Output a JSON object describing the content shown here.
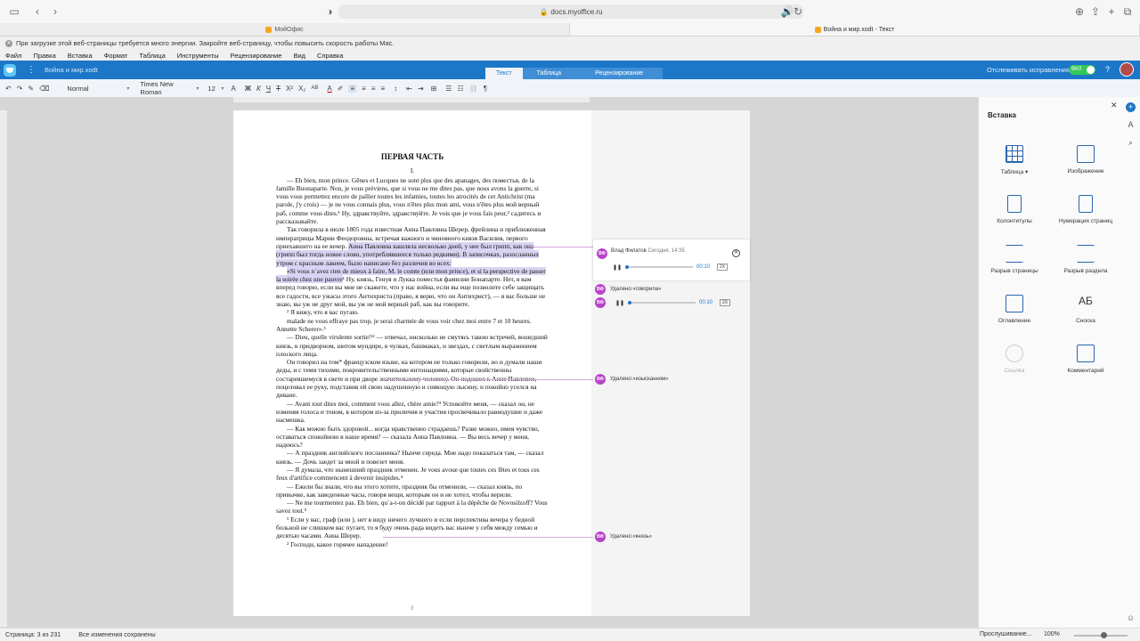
{
  "browser": {
    "url": "docs.myoffice.ru",
    "tabs": [
      {
        "label": "МойОфис",
        "active": false
      },
      {
        "label": "Война и мир.xodt - Текст",
        "active": true
      }
    ],
    "energy_warning": "При загрузке этой веб-страницы требуется много энергии. Закройте веб-страницу, чтобы повысить скорость работы Mac."
  },
  "menu": [
    "Файл",
    "Правка",
    "Вставка",
    "Формат",
    "Таблица",
    "Инструменты",
    "Рецензирование",
    "Вид",
    "Справка"
  ],
  "app": {
    "doc_title": "Война и мир.xodt",
    "mode_tabs": [
      "Текст",
      "Таблица",
      "Рецензирование"
    ],
    "active_mode": "Текст",
    "track_changes_label": "Отслеживать исправления",
    "track_toggle": "ВКЛ",
    "help": "?"
  },
  "toolbar": {
    "style": "Normal",
    "font": "Times New Roman",
    "size": "12",
    "grow_font": "A",
    "bold": "Ж",
    "italic": "К",
    "underline": "Ч",
    "strike": "T",
    "superscript": "X²",
    "subscript": "X₂",
    "case": "AB",
    "font_color": "A",
    "pilcrow": "¶"
  },
  "document": {
    "heading": "ПЕРВАЯ ЧАСТЬ",
    "chapter": "I.",
    "paragraphs": [
      {
        "indent": true,
        "text": "— Eh bien, mon prince. Gênes et Lucques ne sont plus que des apanages, des поместья, de la famille Buonaparte. Non, je vous préviens, que si vous ne me dites pas, que nous avons la guerre, si vous vous permettez encore de pallier toutes les infamies, toutes les atrocités de cet Antichrist (ma parole, j'y crois) — je ne vous connais plus, vous n'êtes plus mon ami, vous n'êtes plus мой верный раб, comme vous dites.¹ Ну, здравствуйте, здравствуйте. Je vois que je vous fais peur,² садитесь и рассказывайте."
      },
      {
        "indent": true,
        "pre": "Так говорила в июле 1805 года известная Анна Павловна Шерер, фрейлина и приближенная императрицы Марии Феодоровны, встречая важного и чиновного князя Василия, первого приехавшего на ее вечер. ",
        "hl": "Анна Павловна кашляла несколько дней, у нее был грипп, как она (грипп был тогда новое слово, употреблявшееся только редкими). В записочках, разосланных утром с красным лакеем, было написано без различия во всех:",
        "post": ""
      },
      {
        "indent": true,
        "pre": "",
        "hl": "«Si vous n`avez rien de mieux à faire, M. le comte (или mon prince), et si la perspective de passer la soirée chez une pauvre",
        "post": "¹ Ну, князь, Генуя и Лукка поместья фамилии Бонапарте. Нет, я вам вперед говорю, если вы мне не скажете, что у нас война, если вы еще позволите себе защищать все гадости, все ужасы этого Антихриста (право, я верю, что он Антихрист), — я вас больше не знаю, вы уж не друг мой, вы уж не мой верный раб, как вы говорите."
      },
      {
        "indent": true,
        "text": "² Я вижу, что я вас пугаю."
      },
      {
        "indent": true,
        "text": "malade ne vous effraye pas trop, je serai charmée de vous voir chez moi entre 7 et 10 heures. Annette Scherer».³"
      },
      {
        "indent": true,
        "text": "— Dieu, quelle virulente sortie!¹² — отвечал, нисколько не смутясь такою встречей, вошедший князь, в придворном, шитом мундире, в чулках, башмаках, и звездах, с светлым выражением плоского лица."
      },
      {
        "indent": true,
        "text": "Он говорил на том* французском языке, на котором не только говорили, но и думали наши деды, и с теми тихими, покровительственными интонациями, которые свойственны состаревшемуся в свете и при дворе значительному человеку. Он подошел к Анне Павловне, поцеловал ее руку, подставив ей свою надушенную и сияющую лысину, и покойно уселся на диване."
      },
      {
        "indent": true,
        "text": "— Avant tout dites moi, comment vous allez, chère amie?³ Успокойте меня, — сказал он, не изменяя голоса и тоном, в котором из-за приличия и участия просвечивало равнодушие и даже насмешка."
      },
      {
        "indent": true,
        "text": "— Как можно быть здоровой... когда нравственно страдаешь? Разве можно, имея чувство, оставаться спокойною в наше время? — сказала Анна Павловна. — Вы весь вечер у меня, надеюсь?"
      },
      {
        "indent": true,
        "text": "— А праздник английского посланника? Нынче середа. Мне надо показаться там, — сказал князь. — Дочь заедет за мной и повезет меня."
      },
      {
        "indent": true,
        "text": "— Я думала, что нынешний праздник отменен. Je vous avoue que toutes ces fêtes et tous ces feux d'artifice commencent à devenir insipides.⁴"
      },
      {
        "indent": true,
        "text": "— Ежели бы знали, что вы этого хотите, праздник бы отменили, — сказал князь, по привычке, как заведенные часы, говоря вещи, которым он и не хотел, чтобы верили."
      },
      {
        "indent": true,
        "text": "— Ne me tourmentez pas. Eh bien, qu`a-t-on décidé par rapport à la dépêche de Novosilzoff? Vous savez tout.⁵"
      },
      {
        "indent": true,
        "text": "¹ Если у вас, граф (или ), нет в виду ничего лучшего и если перспектива вечера у бедной больной не слишком вас пугает, то я буду очень рада видеть вас нынче у себя между семью и десятью часами. Анна Шерер."
      },
      {
        "indent": true,
        "text": "² Господи, какое горячее нападение!"
      }
    ],
    "page_number": "3"
  },
  "comments": {
    "card": {
      "initials": "ВФ",
      "author": "Влад Филатов",
      "time": "Сегодня, 14:35",
      "audio_time": "00:10",
      "speed": "2X"
    },
    "deleted_label": "Удалено:",
    "deleted": [
      {
        "initials": "ВФ",
        "word": "«говорила»"
      },
      {
        "initials": "ВФ",
        "word": "«изысканном»"
      },
      {
        "initials": "ВФ",
        "word": "«князь»"
      }
    ],
    "second_audio": {
      "initials": "ВФ",
      "audio_time": "00:10",
      "speed": "2X"
    }
  },
  "insert_panel": {
    "title": "Вставка",
    "items": [
      {
        "label": "Таблица ▾",
        "icon": "table-icon",
        "enabled": true
      },
      {
        "label": "Изображение",
        "icon": "image-icon",
        "enabled": true
      },
      {
        "label": "Колонтитулы",
        "icon": "header-footer-icon",
        "enabled": true
      },
      {
        "label": "Нумерация страниц",
        "icon": "page-numbering-icon",
        "enabled": true
      },
      {
        "label": "Разрыв страницы",
        "icon": "page-break-icon",
        "enabled": true
      },
      {
        "label": "Разрыв раздела",
        "icon": "section-break-icon",
        "enabled": true
      },
      {
        "label": "Оглавление",
        "icon": "toc-icon",
        "enabled": true
      },
      {
        "label": "Сноска",
        "icon": "footnote-icon",
        "glyph": "АБ",
        "enabled": true
      },
      {
        "label": "Ссылка",
        "icon": "link-icon",
        "enabled": false
      },
      {
        "label": "Комментарий",
        "icon": "comment-icon",
        "enabled": true
      }
    ]
  },
  "status": {
    "page": "Страница: 3 из 231",
    "saved": "Все изменения сохранены",
    "listen": "Прослушивание...",
    "zoom": "100%"
  },
  "colors": {
    "brand": "#1d77c8",
    "reviewer": "#b744c7",
    "highlight": "#d9d4f2",
    "toggle_on": "#34c759"
  }
}
